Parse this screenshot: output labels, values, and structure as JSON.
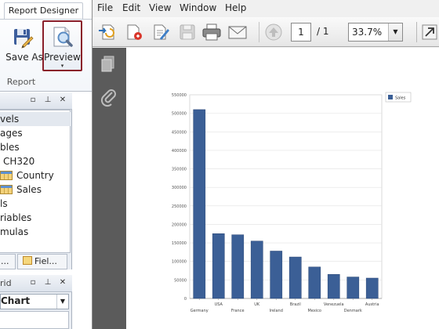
{
  "ribbon": {
    "tab_label": "Report Designer",
    "save_as_label": "Save As",
    "preview_label": "Preview",
    "preview_arrow": "▾",
    "group_label": "Report"
  },
  "dictionary": {
    "items": [
      {
        "label": "vels",
        "selected": true
      },
      {
        "label": "ages"
      },
      {
        "label": "bles"
      },
      {
        "label": "CH320"
      },
      {
        "label": "Country",
        "icon": "table-icon"
      },
      {
        "label": "Sales",
        "icon": "table-icon"
      },
      {
        "label": "ls"
      },
      {
        "label": "riables"
      },
      {
        "label": "mulas"
      }
    ],
    "tabs": [
      "...",
      "Fiel..."
    ]
  },
  "property_grid": {
    "title": "rid",
    "selected_component": "Chart",
    "combo_arrow": "▼"
  },
  "viewer": {
    "menu": [
      "File",
      "Edit",
      "View",
      "Window",
      "Help"
    ],
    "page_current": "1",
    "page_total": "/ 1",
    "zoom": "33.7%",
    "zoom_arrow": "▼"
  },
  "chart_data": {
    "type": "bar",
    "categories": [
      "Germany",
      "USA",
      "France",
      "UK",
      "Ireland",
      "Brazil",
      "Mexico",
      "Venezuela",
      "Denmark",
      "Austria"
    ],
    "series": [
      {
        "name": "Sales",
        "values": [
          510000,
          175000,
          172000,
          155000,
          128000,
          112000,
          85000,
          65000,
          58000,
          55000
        ]
      }
    ],
    "y_ticks": [
      "550000",
      "500000",
      "450000",
      "400000",
      "350000",
      "300000",
      "250000",
      "200000",
      "150000",
      "100000",
      "50000",
      "0"
    ],
    "ylim": [
      0,
      550000
    ],
    "grid": true,
    "legend": "top-right",
    "bar_color": "#3b5f96"
  }
}
